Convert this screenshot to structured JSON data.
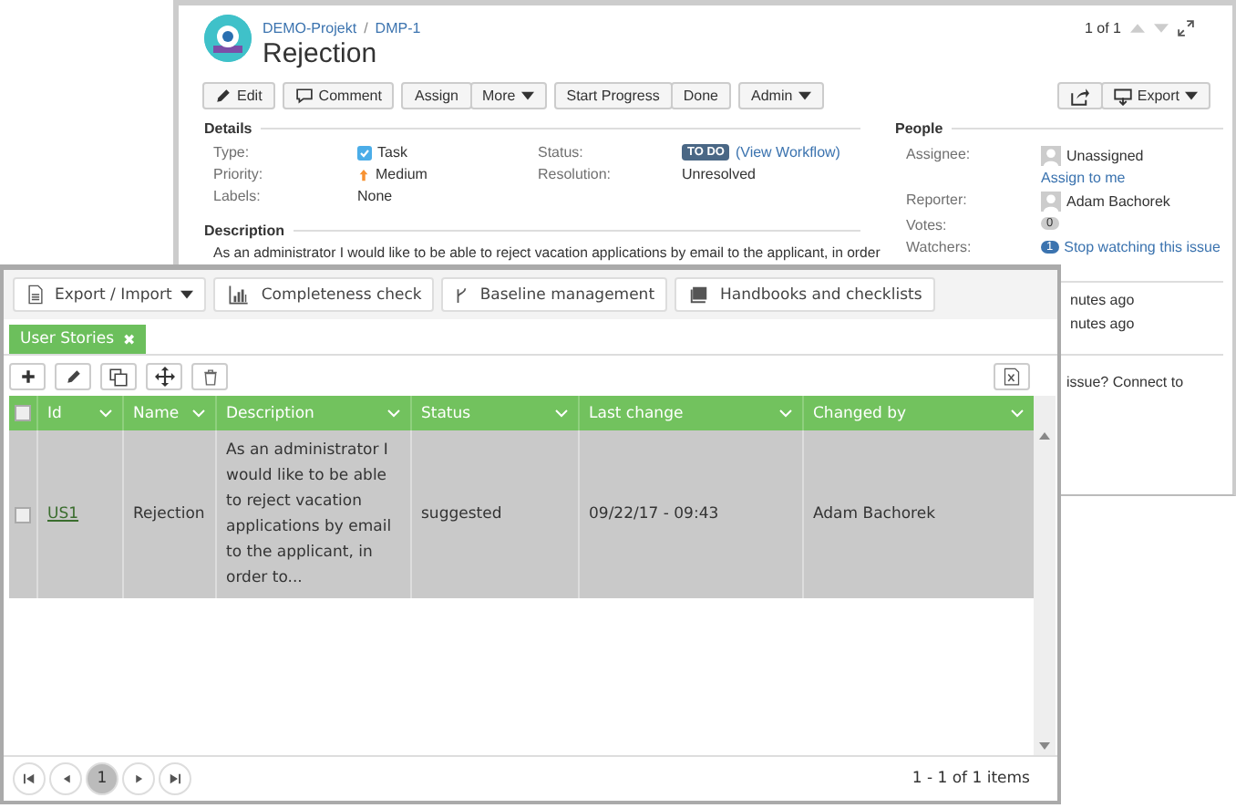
{
  "issue_window": {
    "breadcrumb": [
      {
        "label": "DEMO-Projekt"
      },
      {
        "label": "DMP-1"
      }
    ],
    "separator": "/",
    "title": "Rejection",
    "pager": "1 of 1",
    "toolbar": [
      [
        {
          "label": "Edit",
          "kind": "edit"
        }
      ],
      [
        {
          "label": "Comment",
          "kind": "comment"
        }
      ],
      [
        {
          "label": "Assign",
          "kind": "plain"
        },
        {
          "label": "More",
          "kind": "menu"
        }
      ],
      [
        {
          "label": "Start Progress",
          "kind": "plain"
        },
        {
          "label": "Done",
          "kind": "plain"
        }
      ],
      [
        {
          "label": "Admin",
          "kind": "menu"
        }
      ]
    ],
    "toolbar_right": [
      [
        {
          "kind": "share"
        },
        {
          "label": "Export",
          "kind": "export"
        }
      ]
    ],
    "details": {
      "heading": "Details",
      "fields": [
        {
          "label": "Type:",
          "value": "Task",
          "kind": "type"
        },
        {
          "label": "Status:",
          "kind": "status",
          "badge": "TO DO",
          "link": "(View Workflow)"
        },
        {
          "label": "Priority:",
          "value": "Medium",
          "kind": "priority"
        },
        {
          "label": "Resolution:",
          "value": "Unresolved",
          "kind": "text"
        },
        {
          "label": "Labels:",
          "value": "None",
          "kind": "text"
        }
      ]
    },
    "description": {
      "heading": "Description",
      "text": "As an administrator I would like to be able to reject vacation applications by email to the applicant, in order"
    },
    "people": {
      "heading": "People",
      "fields": [
        {
          "label": "Assignee:",
          "kind": "user",
          "value": "Unassigned",
          "link": "Assign to me"
        },
        {
          "label": "Reporter:",
          "kind": "user",
          "value": "Adam Bachorek"
        },
        {
          "label": "Votes:",
          "kind": "count",
          "badge": "0"
        },
        {
          "label": "Watchers:",
          "kind": "watch",
          "badge": "1",
          "link": "Stop watching this issue"
        }
      ]
    },
    "activity": [
      "nutes ago",
      "nutes ago"
    ],
    "notice": "issue? Connect to"
  },
  "grid_window": {
    "toolbar": [
      {
        "label": "Export / Import",
        "kind": "export",
        "dropdown": true
      },
      {
        "label": "Completeness check",
        "kind": "chart",
        "dropdown": false
      },
      {
        "label": "Baseline management",
        "kind": "branch",
        "dropdown": false
      },
      {
        "label": "Handbooks and checklists",
        "kind": "book",
        "dropdown": false
      }
    ],
    "tabs": [
      {
        "label": "User Stories",
        "close": "✖",
        "selected": true
      }
    ],
    "actions": [
      {
        "kind": "add"
      },
      {
        "kind": "edit"
      },
      {
        "kind": "copy"
      },
      {
        "kind": "move"
      },
      {
        "kind": "delete"
      },
      {
        "kind": "excel"
      }
    ],
    "all_checked": false,
    "columns": [
      {
        "label": "Id",
        "kind": "link"
      },
      {
        "label": "Name",
        "kind": "text"
      },
      {
        "label": "Description",
        "kind": "text"
      },
      {
        "label": "Status",
        "kind": "text"
      },
      {
        "label": "Last change",
        "kind": "text"
      },
      {
        "label": "Changed by",
        "kind": "text"
      }
    ],
    "rows": [
      {
        "selected": true,
        "checked": false,
        "cells": [
          "US1",
          "Rejection",
          "As an administrator I would like to be able to reject vacation applications by email to the applicant, in order to...",
          "suggested",
          "09/22/17 - 09:43",
          "Adam Bachorek"
        ]
      }
    ],
    "pages": [
      {
        "label": "1",
        "selected": true
      }
    ],
    "summary": "1 - 1 of 1 items"
  }
}
